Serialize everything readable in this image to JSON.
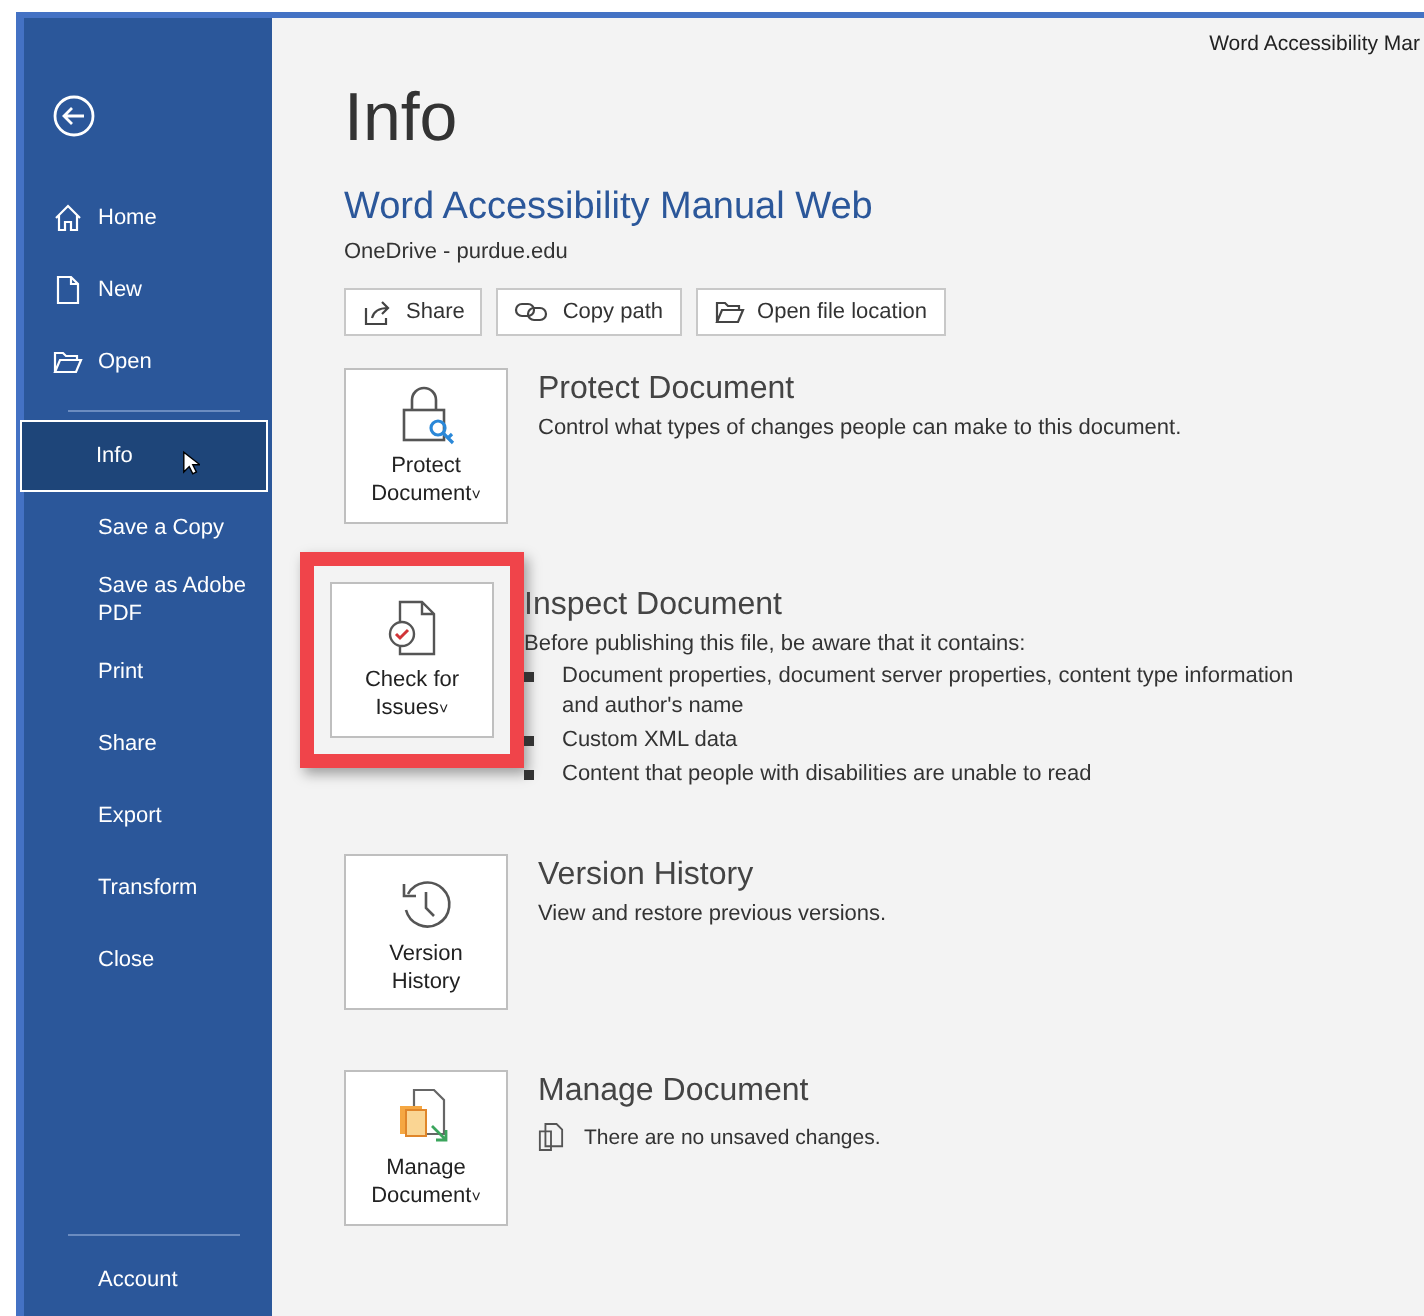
{
  "window": {
    "title": "Word Accessibility Mar"
  },
  "sidebar": {
    "items": [
      {
        "label": "Home",
        "kind": "home",
        "selected": false
      },
      {
        "label": "New",
        "kind": "new",
        "selected": false
      },
      {
        "label": "Open",
        "kind": "open",
        "selected": false
      },
      {
        "label": "Info",
        "kind": "text",
        "selected": true
      },
      {
        "label": "Save a Copy",
        "kind": "text",
        "selected": false
      },
      {
        "label": "Save as Adobe PDF",
        "kind": "text",
        "selected": false
      },
      {
        "label": "Print",
        "kind": "text",
        "selected": false
      },
      {
        "label": "Share",
        "kind": "text",
        "selected": false
      },
      {
        "label": "Export",
        "kind": "text",
        "selected": false
      },
      {
        "label": "Transform",
        "kind": "text",
        "selected": false
      },
      {
        "label": "Close",
        "kind": "text",
        "selected": false
      }
    ],
    "footer": "Account"
  },
  "page": {
    "heading": "Info",
    "doc_title": "Word Accessibility Manual Web",
    "location": "OneDrive - purdue.edu",
    "actions": [
      {
        "label": "Share",
        "kind": "share"
      },
      {
        "label": "Copy path",
        "kind": "link"
      },
      {
        "label": "Open file location",
        "kind": "folder"
      }
    ],
    "sections": [
      {
        "kind": "protect",
        "button": [
          "Protect",
          "Document"
        ],
        "caret": "˅",
        "highlighted": false,
        "title": "Protect Document",
        "description": "Control what types of changes people can make to this document."
      },
      {
        "kind": "inspect",
        "button": [
          "Check for",
          "Issues"
        ],
        "caret": "˅",
        "highlighted": true,
        "title": "Inspect Document",
        "description": "Before publishing this file, be aware that it contains:",
        "bullets": [
          "Document properties, document server properties, content type information and author's name",
          "Custom XML data",
          "Content that people with disabilities are unable to read"
        ]
      },
      {
        "kind": "history",
        "button": [
          "Version",
          "History"
        ],
        "highlighted": false,
        "title": "Version History",
        "description": "View and restore previous versions."
      },
      {
        "kind": "manage",
        "button": [
          "Manage",
          "Document"
        ],
        "caret": "˅",
        "highlighted": false,
        "title": "Manage Document",
        "status": "There are no unsaved changes."
      }
    ]
  }
}
